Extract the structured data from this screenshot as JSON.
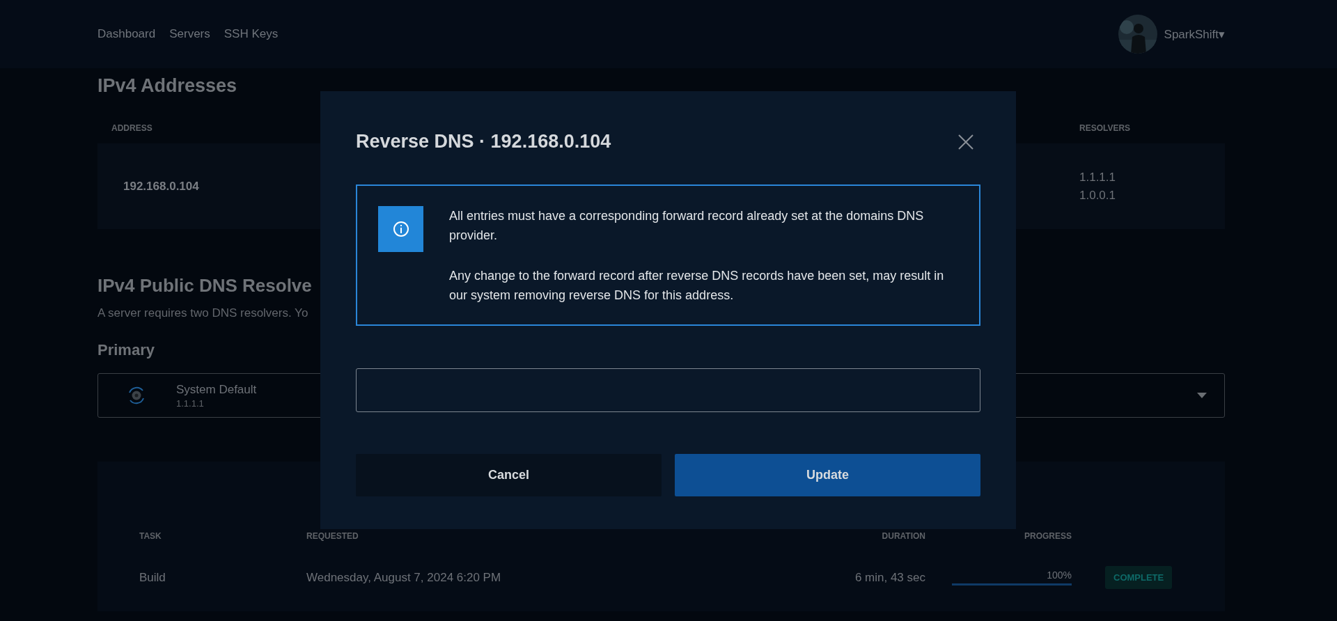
{
  "nav": {
    "links": [
      "Dashboard",
      "Servers",
      "SSH Keys"
    ],
    "user": {
      "name": "SparkShift",
      "caret": "▾"
    }
  },
  "ipv4": {
    "title": "IPv4 Addresses",
    "columns": [
      "ADDRESS",
      "RESOLVERS"
    ],
    "rows": [
      {
        "address": "192.168.0.104",
        "resolvers": [
          "1.1.1.1",
          "1.0.0.1"
        ]
      }
    ]
  },
  "resolvers": {
    "title": "IPv4 Public DNS Resolve",
    "description": "A server requires two DNS resolvers. Yo",
    "primary": {
      "label": "Primary",
      "name": "System Default",
      "address": "1.1.1.1"
    }
  },
  "tasks": {
    "columns": [
      "TASK",
      "REQUESTED",
      "DURATION",
      "PROGRESS"
    ],
    "rows": [
      {
        "task": "Build",
        "requested": "Wednesday, August 7, 2024 6:20 PM",
        "duration": "6 min, 43 sec",
        "progress": "100%",
        "level": 1,
        "status": "COMPLETE"
      }
    ]
  },
  "modal": {
    "title": "Reverse DNS · 192.168.0.104",
    "notice": [
      "All entries must have a corresponding forward record already set at the domains DNS provider.",
      "Any change to the forward record after reverse DNS records have been set, may result in our system removing reverse DNS for this address."
    ],
    "buttons": [
      {
        "label": "Cancel",
        "kind": "secondary"
      },
      {
        "label": "Update",
        "kind": "primary"
      }
    ]
  }
}
